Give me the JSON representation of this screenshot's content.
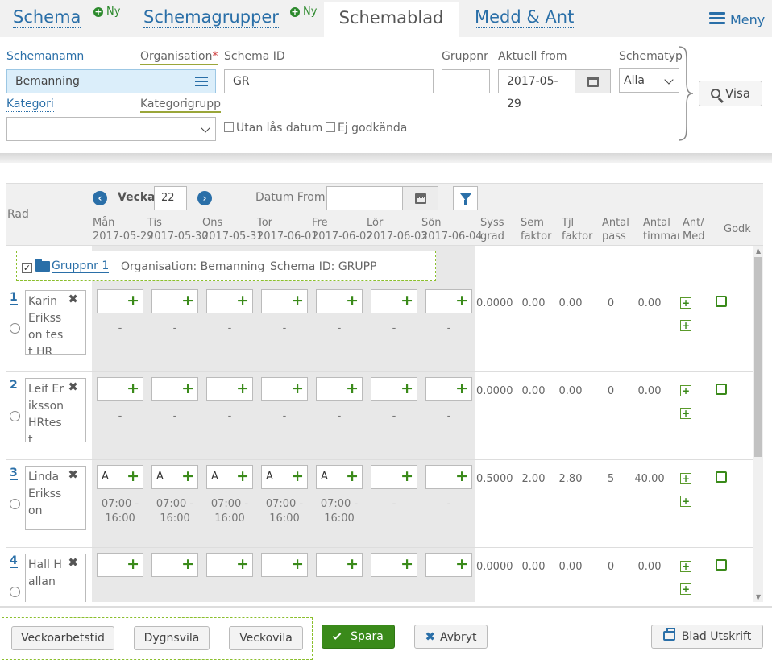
{
  "nav": {
    "schema": "Schema",
    "ny1": "Ny",
    "schemagrupper": "Schemagrupper",
    "ny2": "Ny",
    "schemablad": "Schemablad",
    "medd": "Medd & Ant",
    "meny": "Meny"
  },
  "form": {
    "schemanamn_label": "Schemanamn",
    "organisation_label": "Organisation",
    "required_mark": "*",
    "organisation_value": "Bemanning",
    "kategori_label": "Kategori",
    "kategorigrupp_label": "Kategorigrupp",
    "kategori_value": "",
    "schema_id_label": "Schema ID",
    "schema_id_value": "GR",
    "gruppnr_label": "Gruppnr",
    "gruppnr_value": "",
    "aktuell_from_label": "Aktuell from",
    "aktuell_from_value": "2017-05-29",
    "schematyp_label": "Schematyp",
    "schematyp_value": "Alla",
    "utan_las_label": "Utan lås datum",
    "ej_godkanda_label": "Ej godkända",
    "visa_label": "Visa"
  },
  "grid": {
    "rad_label": "Rad",
    "vecka_label": "Vecka",
    "vecka_value": "22",
    "prev_icon": "chevron-left-icon",
    "next_icon": "chevron-right-icon",
    "datum_from_label": "Datum From",
    "datum_from_value": "",
    "days": [
      {
        "name": "Mån",
        "date": "2017-05-29"
      },
      {
        "name": "Tis",
        "date": "2017-05-30"
      },
      {
        "name": "Ons",
        "date": "2017-05-31"
      },
      {
        "name": "Tor",
        "date": "2017-06-01"
      },
      {
        "name": "Fre",
        "date": "2017-06-02"
      },
      {
        "name": "Lör",
        "date": "2017-06-03"
      },
      {
        "name": "Sön",
        "date": "2017-06-04"
      }
    ],
    "stat_headers": {
      "syss": "Syss\ngrad",
      "sem": "Sem\nfaktor",
      "tjl": "Tjl\nfaktor",
      "antal_pass": "Antal\npass",
      "antal_timmar": "Antal\ntimmar",
      "ant_med": "Ant/\nMed",
      "godk": "Godk"
    },
    "group": {
      "name": "Gruppnr 1",
      "organisation": "Organisation: Bemanning",
      "schema_id": "Schema ID: GRUPP"
    },
    "rows": [
      {
        "num": "1",
        "name": "Karin Eriksson test HR",
        "cells": [
          {
            "code": "",
            "time": "-"
          },
          {
            "code": "",
            "time": "-"
          },
          {
            "code": "",
            "time": "-"
          },
          {
            "code": "",
            "time": "-"
          },
          {
            "code": "",
            "time": "-"
          },
          {
            "code": "",
            "time": "-"
          },
          {
            "code": "",
            "time": "-"
          }
        ],
        "syss": "0.0000",
        "sem": "0.00",
        "tjl": "0.00",
        "pass": "0",
        "timmar": "0.00"
      },
      {
        "num": "2",
        "name": "Leif Eriksson HRtest",
        "cells": [
          {
            "code": "",
            "time": "-"
          },
          {
            "code": "",
            "time": "-"
          },
          {
            "code": "",
            "time": "-"
          },
          {
            "code": "",
            "time": "-"
          },
          {
            "code": "",
            "time": "-"
          },
          {
            "code": "",
            "time": "-"
          },
          {
            "code": "",
            "time": "-"
          }
        ],
        "syss": "0.0000",
        "sem": "0.00",
        "tjl": "0.00",
        "pass": "0",
        "timmar": "0.00"
      },
      {
        "num": "3",
        "name": "Linda Eriksson",
        "cells": [
          {
            "code": "A",
            "time": "07:00 -\n16:00"
          },
          {
            "code": "A",
            "time": "07:00 -\n16:00"
          },
          {
            "code": "A",
            "time": "07:00 -\n16:00"
          },
          {
            "code": "A",
            "time": "07:00 -\n16:00"
          },
          {
            "code": "A",
            "time": "07:00 -\n16:00"
          },
          {
            "code": "",
            "time": "-"
          },
          {
            "code": "",
            "time": "-"
          }
        ],
        "syss": "0.5000",
        "sem": "2.00",
        "tjl": "2.80",
        "pass": "5",
        "timmar": "40.00"
      },
      {
        "num": "4",
        "name": "Hall Hallan",
        "cells": [
          {
            "code": "",
            "time": ""
          },
          {
            "code": "",
            "time": ""
          },
          {
            "code": "",
            "time": ""
          },
          {
            "code": "",
            "time": ""
          },
          {
            "code": "",
            "time": ""
          },
          {
            "code": "",
            "time": ""
          },
          {
            "code": "",
            "time": ""
          }
        ],
        "syss": "0.0000",
        "sem": "0.00",
        "tjl": "0.00",
        "pass": "0",
        "timmar": "0.00"
      }
    ]
  },
  "footer": {
    "veckoarbetstid": "Veckoarbetstid",
    "dygnsvila": "Dygnsvila",
    "veckovila": "Veckovila",
    "spara": "Spara",
    "avbryt": "Avbryt",
    "blad_utskrift": "Blad Utskrift"
  },
  "colors": {
    "link_blue": "#2a6fa8",
    "save_green": "#3a8a1a",
    "org_field_bg": "#dbeefa"
  }
}
